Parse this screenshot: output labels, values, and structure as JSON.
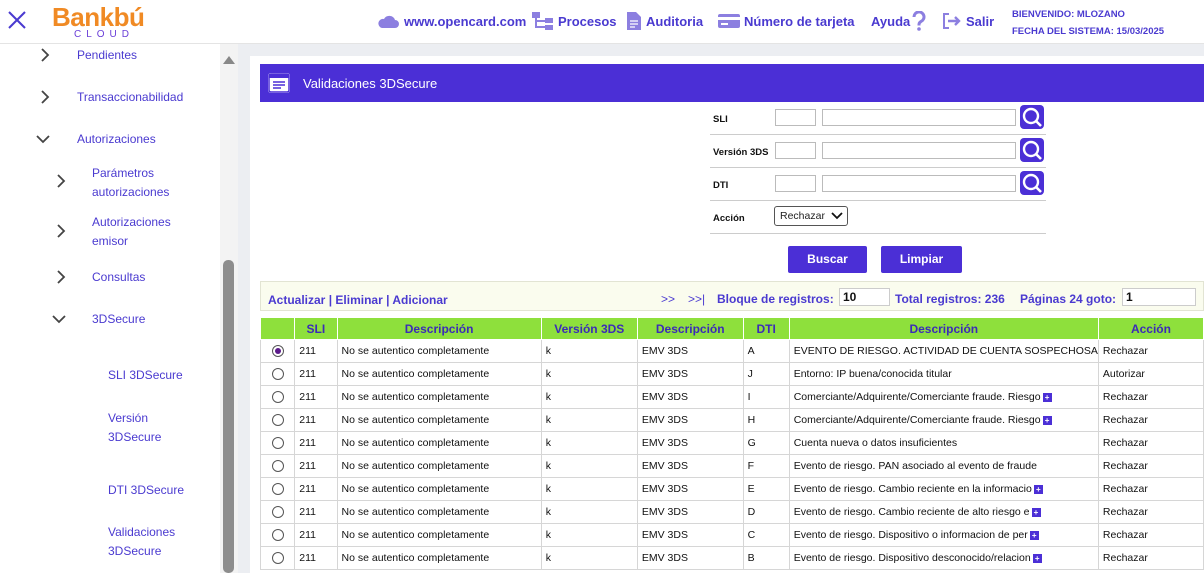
{
  "header": {
    "logo_main": "Bankbú",
    "logo_sub": "CLOUD",
    "nav": [
      {
        "label": "www.opencard.com",
        "icon": "cloud-icon"
      },
      {
        "label": "Procesos",
        "icon": "sitemap-icon"
      },
      {
        "label": "Auditoria",
        "icon": "document-icon"
      },
      {
        "label": "Número de tarjeta",
        "icon": "card-icon"
      },
      {
        "label": "Ayuda",
        "icon": "help-icon"
      },
      {
        "label": "Salir",
        "icon": "logout-icon"
      }
    ],
    "welcome": "BIENVENIDO: MLOZANO",
    "system_date": "FECHA DEL SISTEMA: 15/03/2025"
  },
  "sidebar": {
    "items": [
      {
        "label": "Pendientes",
        "state": "collapsed"
      },
      {
        "label": "Transaccionabilidad",
        "state": "collapsed"
      },
      {
        "label": "Autorizaciones",
        "state": "expanded"
      },
      {
        "label": "Parámetros autorizaciones",
        "line1": "Parámetros",
        "line2": "autorizaciones",
        "state": "collapsed"
      },
      {
        "label": "Autorizaciones emisor",
        "line1": "Autorizaciones",
        "line2": "emisor",
        "state": "collapsed"
      },
      {
        "label": "Consultas",
        "state": "collapsed"
      },
      {
        "label": "3DSecure",
        "state": "expanded"
      }
    ],
    "leaves": [
      {
        "label": "SLI 3DSecure"
      },
      {
        "label": "Versión 3DSecure",
        "line1": "Versión",
        "line2": "3DSecure"
      },
      {
        "label": "DTI 3DSecure"
      },
      {
        "label": "Validaciones 3DSecure",
        "line1": "Validaciones",
        "line2": "3DSecure"
      }
    ]
  },
  "page": {
    "title": "Validaciones 3DSecure"
  },
  "form": {
    "sli_label": "SLI",
    "version_label": "Versión 3DS",
    "dti_label": "DTI",
    "accion_label": "Acción",
    "accion_value": "Rechazar",
    "sli_code": "",
    "sli_desc": "",
    "version_code": "",
    "version_desc": "",
    "dti_code": "",
    "dti_desc": "",
    "buscar": "Buscar",
    "limpiar": "Limpiar"
  },
  "toolbar": {
    "actualizar": "Actualizar",
    "eliminar": "Eliminar",
    "adicionar": "Adicionar",
    "sep": "|",
    "next": ">>",
    "last": ">>|",
    "bloque_label": "Bloque de registros:",
    "bloque_value": "10",
    "total_label": "Total registros: 236",
    "paginas_label": "Páginas 24 goto:",
    "goto_value": "1"
  },
  "table": {
    "headers": [
      "",
      "SLI",
      "Descripción",
      "Versión 3DS",
      "Descripción",
      "DTI",
      "Descripción",
      "Acción"
    ],
    "rows": [
      {
        "selected": true,
        "sli": "211",
        "sli_desc": "No se autentico completamente",
        "version": "k",
        "version_desc": "EMV 3DS",
        "dti": "A",
        "dti_desc": "EVENTO DE RIESGO. ACTIVIDAD DE CUENTA SOSPECHOSA",
        "more": false,
        "accion": "Rechazar"
      },
      {
        "selected": false,
        "sli": "211",
        "sli_desc": "No se autentico completamente",
        "version": "k",
        "version_desc": "EMV 3DS",
        "dti": "J",
        "dti_desc": "Entorno: IP buena/conocida titular",
        "more": false,
        "accion": "Autorizar"
      },
      {
        "selected": false,
        "sli": "211",
        "sli_desc": "No se autentico completamente",
        "version": "k",
        "version_desc": "EMV 3DS",
        "dti": "I",
        "dti_desc": "Comerciante/Adquirente/Comerciante fraude. Riesgo",
        "more": true,
        "accion": "Rechazar"
      },
      {
        "selected": false,
        "sli": "211",
        "sli_desc": "No se autentico completamente",
        "version": "k",
        "version_desc": "EMV 3DS",
        "dti": "H",
        "dti_desc": "Comerciante/Adquirente/Comerciante fraude. Riesgo",
        "more": true,
        "accion": "Rechazar"
      },
      {
        "selected": false,
        "sli": "211",
        "sli_desc": "No se autentico completamente",
        "version": "k",
        "version_desc": "EMV 3DS",
        "dti": "G",
        "dti_desc": "Cuenta nueva o datos insuficientes",
        "more": false,
        "accion": "Rechazar"
      },
      {
        "selected": false,
        "sli": "211",
        "sli_desc": "No se autentico completamente",
        "version": "k",
        "version_desc": "EMV 3DS",
        "dti": "F",
        "dti_desc": "Evento de riesgo. PAN asociado al evento de fraude",
        "more": false,
        "accion": "Rechazar"
      },
      {
        "selected": false,
        "sli": "211",
        "sli_desc": "No se autentico completamente",
        "version": "k",
        "version_desc": "EMV 3DS",
        "dti": "E",
        "dti_desc": "Evento de riesgo. Cambio reciente en la informacio",
        "more": true,
        "accion": "Rechazar"
      },
      {
        "selected": false,
        "sli": "211",
        "sli_desc": "No se autentico completamente",
        "version": "k",
        "version_desc": "EMV 3DS",
        "dti": "D",
        "dti_desc": "Evento de riesgo. Cambio reciente de alto riesgo e",
        "more": true,
        "accion": "Rechazar"
      },
      {
        "selected": false,
        "sli": "211",
        "sli_desc": "No se autentico completamente",
        "version": "k",
        "version_desc": "EMV 3DS",
        "dti": "C",
        "dti_desc": "Evento de riesgo. Dispositivo o informacion de per",
        "more": true,
        "accion": "Rechazar"
      },
      {
        "selected": false,
        "sli": "211",
        "sli_desc": "No se autentico completamente",
        "version": "k",
        "version_desc": "EMV 3DS",
        "dti": "B",
        "dti_desc": "Evento de riesgo. Dispositivo desconocido/relacion",
        "more": true,
        "accion": "Rechazar"
      }
    ]
  },
  "colors": {
    "accent": "#4b2fd6",
    "table_header": "#8ee03c",
    "brand_orange": "#f08a24"
  }
}
